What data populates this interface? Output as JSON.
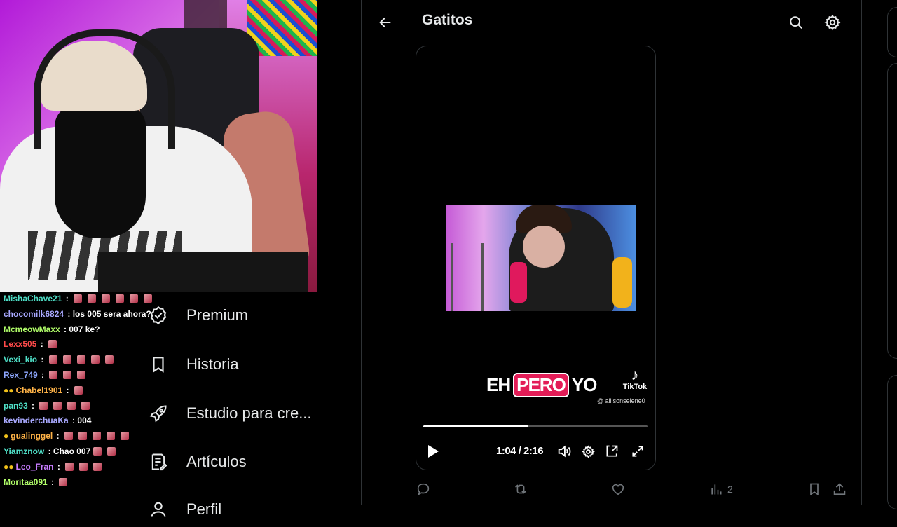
{
  "header": {
    "title": "Gatitos"
  },
  "chat": [
    {
      "user": "MishaChave21",
      "color": "#4fe0c8",
      "msg": "",
      "emotes": 6,
      "badges": ""
    },
    {
      "user": "chocomilk6824",
      "color": "#a9a9ff",
      "msg": "los 005 sera ahora?",
      "emotes": 0,
      "badges": ""
    },
    {
      "user": "McmeowMaxx",
      "color": "#b2ff6a",
      "msg": "007 ke?",
      "emotes": 0,
      "badges": ""
    },
    {
      "user": "Lexx505",
      "color": "#ff4a4a",
      "msg": "",
      "emotes": 1,
      "badges": ""
    },
    {
      "user": "Vexi_kio",
      "color": "#4fe0c8",
      "msg": "",
      "emotes": 5,
      "badges": ""
    },
    {
      "user": "Rex_749",
      "color": "#8fa8ff",
      "msg": "",
      "emotes": 3,
      "badges": ""
    },
    {
      "user": "Chabel1901",
      "color": "#ffb347",
      "msg": "",
      "emotes": 1,
      "badges": "●●"
    },
    {
      "user": "pan93",
      "color": "#4fe0c8",
      "msg": "",
      "emotes": 4,
      "badges": ""
    },
    {
      "user": "kevinderchuaKa",
      "color": "#a9a9ff",
      "msg": "004",
      "emotes": 0,
      "badges": ""
    },
    {
      "user": "gualinggel",
      "color": "#ffb347",
      "msg": "",
      "emotes": 5,
      "badges": "●"
    },
    {
      "user": "Yiamznow",
      "color": "#4fe0c8",
      "msg": "Chao 007",
      "emotes": 2,
      "badges": ""
    },
    {
      "user": "Leo_Fran",
      "color": "#c77dff",
      "msg": "",
      "emotes": 3,
      "badges": "●●"
    },
    {
      "user": "Moritaa091",
      "color": "#b2ff6a",
      "msg": "",
      "emotes": 1,
      "badges": ""
    }
  ],
  "nav": {
    "items": [
      {
        "label": "Premium",
        "icon": "verified-icon"
      },
      {
        "label": "Historia",
        "icon": "bookmark-icon"
      },
      {
        "label": "Estudio para cre...",
        "icon": "rocket-icon"
      },
      {
        "label": "Artículos",
        "icon": "articles-icon"
      },
      {
        "label": "Perfil",
        "icon": "profile-icon"
      }
    ]
  },
  "video": {
    "caption_pre": "EH",
    "caption_highlight": "PERO",
    "caption_post": "YO",
    "tiktok_label": "TikTok",
    "tiktok_handle": "@ allisonselene0",
    "time": "1:04 / 2:16",
    "progress": 0.47
  },
  "actions": {
    "views": "2"
  }
}
